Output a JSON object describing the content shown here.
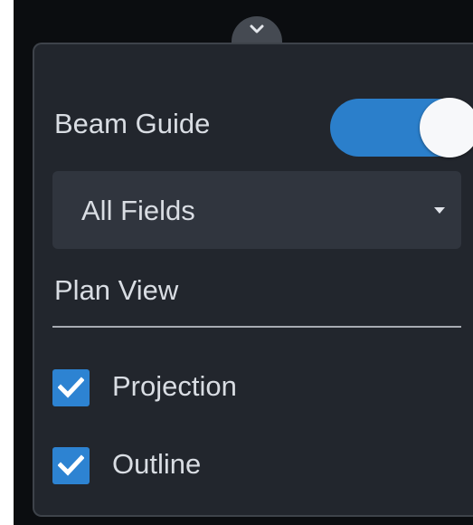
{
  "panel": {
    "beam_guide": {
      "label": "Beam Guide",
      "enabled": true
    },
    "field_select": {
      "value": "All Fields"
    },
    "section_title": "Plan View",
    "options": [
      {
        "label": "Projection",
        "checked": true
      },
      {
        "label": "Outline",
        "checked": true
      }
    ]
  },
  "icons": {
    "collapse": "chevron-down-icon",
    "dropdown": "caret-down-icon",
    "check": "checkmark-icon"
  },
  "colors": {
    "accent": "#2b7fcb",
    "panel_bg": "#22262d",
    "text": "#d9dde3"
  }
}
